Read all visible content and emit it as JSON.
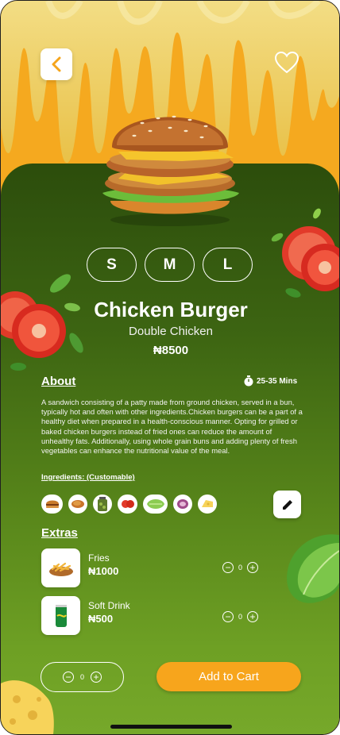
{
  "product": {
    "name": "Chicken Burger",
    "variant": "Double Chicken",
    "price": "₦8500"
  },
  "sizes": [
    "S",
    "M",
    "L"
  ],
  "about": {
    "heading": "About",
    "time": "25-35 Mins",
    "text": "A sandwich consisting of a patty made from ground chicken, served in a bun, typically hot and often with other ingredients.Chicken burgers can be a part of a healthy diet when prepared in a health-conscious manner. Opting for grilled or baked chicken burgers instead of fried ones can reduce the amount of unhealthy fats. Additionally, using whole grain buns and adding plenty of fresh vegetables can enhance the nutritional value of the meal."
  },
  "ingredients": {
    "heading": "Ingredients: (Customable)",
    "items": [
      "bun-icon",
      "chicken-icon",
      "pickle-jar-icon",
      "tomato-icon",
      "lettuce-icon",
      "onion-icon",
      "cheese-icon"
    ]
  },
  "extras": {
    "heading": "Extras",
    "items": [
      {
        "name": "Fries",
        "price": "₦1000",
        "qty": "0"
      },
      {
        "name": "Soft Drink",
        "price": "₦500",
        "qty": "0"
      }
    ]
  },
  "cart": {
    "qty": "0",
    "button_label": "Add to Cart"
  },
  "colors": {
    "accent": "#f7a51c",
    "panel_top": "#2c4d0c",
    "panel_bottom": "#76a82a"
  }
}
